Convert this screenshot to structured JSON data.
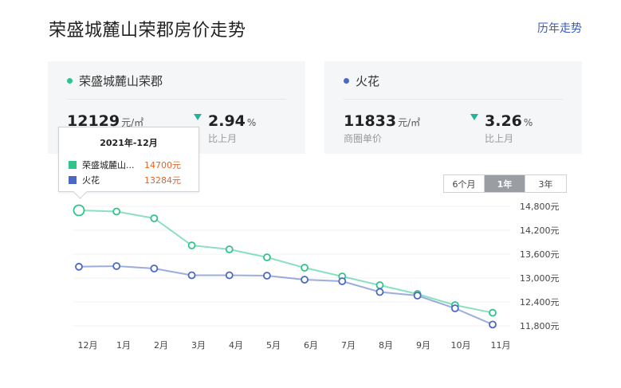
{
  "header": {
    "title": "荣盛城麓山荣郡房价走势",
    "history_link": "历年走势"
  },
  "cards": [
    {
      "name": "荣盛城麓山荣郡",
      "dot_color": "#2ec48b",
      "price": "12129",
      "unit": "元/㎡",
      "change": "2.94",
      "change_unit": "%",
      "change_label": "比上月"
    },
    {
      "name": "火花",
      "dot_color": "#4a68c4",
      "price": "11833",
      "unit": "元/㎡",
      "price_label": "商圈单价",
      "change": "3.26",
      "change_unit": "%",
      "change_label": "比上月"
    }
  ],
  "range_buttons": [
    "6个月",
    "1年",
    "3年"
  ],
  "active_range": "1年",
  "tooltip": {
    "title": "2021年-12月",
    "rows": [
      {
        "name": "荣盛城麓山...",
        "value": "14700元",
        "color": "#2ec48b"
      },
      {
        "name": "火花",
        "value": "13284元",
        "color": "#4a68c4"
      }
    ]
  },
  "chart_data": {
    "type": "line",
    "categories": [
      "12月",
      "1月",
      "2月",
      "3月",
      "4月",
      "5月",
      "6月",
      "7月",
      "8月",
      "9月",
      "10月",
      "11月"
    ],
    "yticks": [
      "14,800元",
      "14,200元",
      "13,600元",
      "13,000元",
      "12,400元",
      "11,800元"
    ],
    "ylim": [
      11800,
      14800
    ],
    "grid": true,
    "series": [
      {
        "name": "荣盛城麓山荣郡",
        "color": "#2ec48b",
        "values": [
          14700,
          14670,
          14500,
          13820,
          13720,
          13520,
          13260,
          13040,
          12820,
          12600,
          12320,
          12129
        ]
      },
      {
        "name": "火花",
        "color": "#4a68c4",
        "values": [
          13284,
          13300,
          13240,
          13070,
          13070,
          13060,
          12960,
          12920,
          12650,
          12560,
          12240,
          11833
        ]
      }
    ]
  }
}
